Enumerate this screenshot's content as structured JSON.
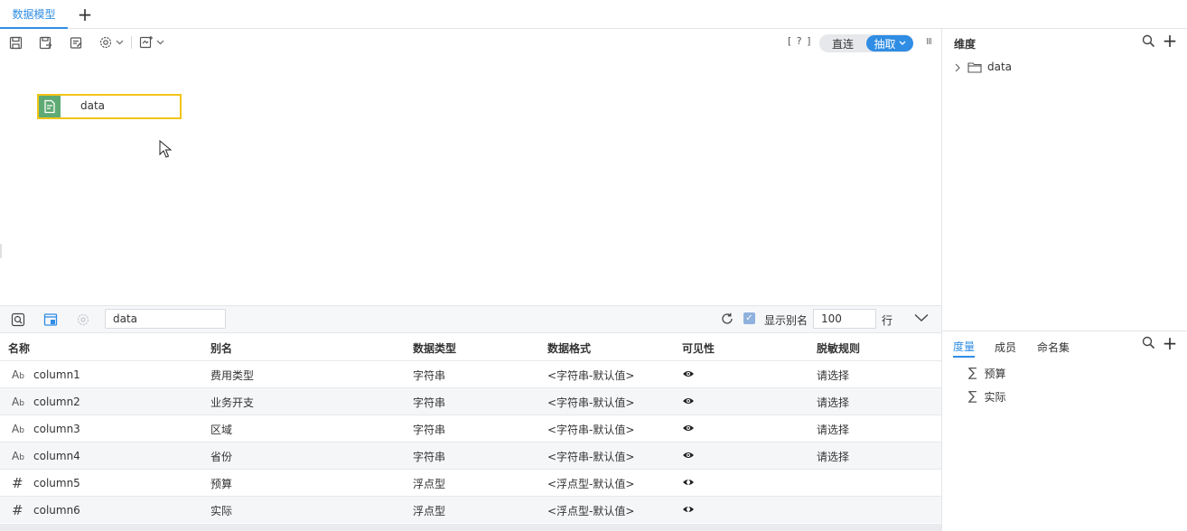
{
  "tabs": {
    "active_label": "数据模型",
    "add_label": "+"
  },
  "toolbar": {
    "help_label": "[ ? ]",
    "mode_direct": "直连",
    "mode_extract": "抽取",
    "handle_glyph": "III"
  },
  "canvas": {
    "table_node_label": "data"
  },
  "dimension_panel": {
    "title": "维度",
    "add_label": "+",
    "items": [
      {
        "label": "data"
      }
    ]
  },
  "measure_panel": {
    "tabs": [
      "度量",
      "成员",
      "命名集"
    ],
    "add_label": "+",
    "items": [
      {
        "label": "预算"
      },
      {
        "label": "实际"
      }
    ]
  },
  "field_panel": {
    "search_value": "data",
    "show_alias_label": "显示别名",
    "show_alias_checked": true,
    "rows_value": "100",
    "rows_unit": "行",
    "headers": [
      "名称",
      "别名",
      "数据类型",
      "数据格式",
      "可见性",
      "脱敏规则"
    ],
    "rows": [
      {
        "type_icon": "Ab",
        "name": "column1",
        "alias": "费用类型",
        "dtype": "字符串",
        "format": "<字符串-默认值>",
        "visible": "eye-open",
        "masking": "请选择"
      },
      {
        "type_icon": "Ab",
        "name": "column2",
        "alias": "业务开支",
        "dtype": "字符串",
        "format": "<字符串-默认值>",
        "visible": "eye-open",
        "masking": "请选择"
      },
      {
        "type_icon": "Ab",
        "name": "column3",
        "alias": "区域",
        "dtype": "字符串",
        "format": "<字符串-默认值>",
        "visible": "eye-open",
        "masking": "请选择"
      },
      {
        "type_icon": "Ab",
        "name": "column4",
        "alias": "省份",
        "dtype": "字符串",
        "format": "<字符串-默认值>",
        "visible": "eye-open",
        "masking": "请选择"
      },
      {
        "type_icon": "#",
        "name": "column5",
        "alias": "预算",
        "dtype": "浮点型",
        "format": "<浮点型-默认值>",
        "visible": "eye-half",
        "masking": ""
      },
      {
        "type_icon": "#",
        "name": "column6",
        "alias": "实际",
        "dtype": "浮点型",
        "format": "<浮点型-默认值>",
        "visible": "eye-half",
        "masking": ""
      }
    ]
  },
  "colors": {
    "accent": "#2f8de4",
    "node_border": "#f2c418",
    "node_icon_bg": "#5faa74"
  }
}
